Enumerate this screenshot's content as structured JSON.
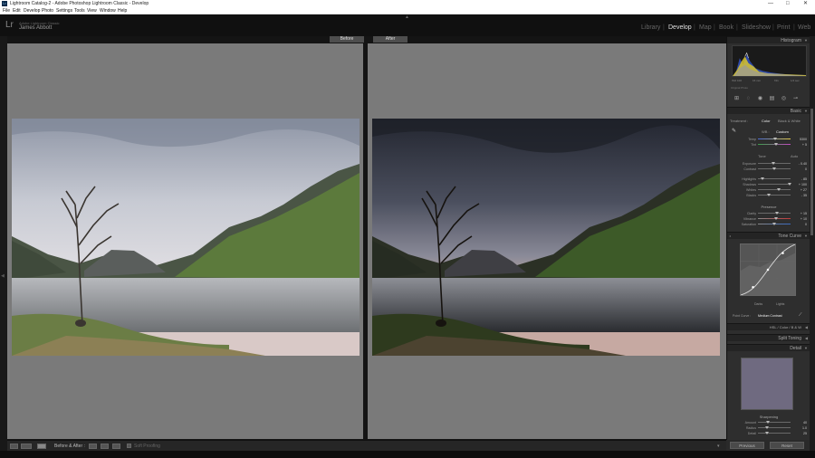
{
  "window": {
    "title": "Lightroom Catalog-2 - Adobe Photoshop Lightroom Classic - Develop",
    "controls": {
      "minimize": "—",
      "maximize": "□",
      "close": "✕"
    }
  },
  "menu": [
    "File",
    "Edit",
    "Develop",
    "Photo",
    "Settings",
    "Tools",
    "View",
    "Window",
    "Help"
  ],
  "identity": {
    "logo": "Lr",
    "catalog": "Adobe Lightroom Classic",
    "user": "James Abbott"
  },
  "modules": [
    {
      "label": "Library",
      "active": false
    },
    {
      "label": "Develop",
      "active": true
    },
    {
      "label": "Map",
      "active": false
    },
    {
      "label": "Book",
      "active": false
    },
    {
      "label": "Slideshow",
      "active": false
    },
    {
      "label": "Print",
      "active": false
    },
    {
      "label": "Web",
      "active": false
    }
  ],
  "compare": {
    "before": "Before",
    "after": "After"
  },
  "toolbar": {
    "view_mode": "Before & After :",
    "soft_proofing": "Soft Proofing"
  },
  "panels": {
    "histogram": {
      "title": "Histogram",
      "meta": [
        "ISO 100",
        "16 mm",
        "f/11",
        "1/4 sec"
      ],
      "original": "Original Photo"
    },
    "basic": {
      "title": "Basic",
      "treatment_label": "Treatment :",
      "treatment_color": "Color",
      "treatment_bw": "Black & White",
      "wb_label": "WB :",
      "wb_value": "Custom",
      "rows_wb": [
        {
          "label": "Temp",
          "value": "5300"
        },
        {
          "label": "Tint",
          "value": "+ 5"
        }
      ],
      "tone_head": "Tone",
      "tone_auto": "Auto",
      "rows_tone": [
        {
          "label": "Exposure",
          "value": "- 0.40"
        },
        {
          "label": "Contrast",
          "value": "0"
        },
        {
          "label": "Highlights",
          "value": "- 85"
        },
        {
          "label": "Shadows",
          "value": "+ 100"
        },
        {
          "label": "Whites",
          "value": "+ 27"
        },
        {
          "label": "Blacks",
          "value": "- 35"
        }
      ],
      "presence_head": "Presence",
      "rows_presence": [
        {
          "label": "Clarity",
          "value": "+ 15"
        },
        {
          "label": "Vibrance",
          "value": "+ 10"
        },
        {
          "label": "Saturation",
          "value": "0"
        }
      ]
    },
    "tone_curve": {
      "title": "Tone Curve",
      "lights": "Lights",
      "darks": "Darks",
      "channel_label": "Point Curve :",
      "channel_value": "Medium Contrast"
    },
    "hsl": {
      "title": "HSL / Color / B&W",
      "tabs": [
        "HSL",
        "Color",
        "B & W"
      ]
    },
    "split_toning": {
      "title": "Split Toning"
    },
    "detail": {
      "title": "Detail",
      "sharpening": "Sharpening",
      "rows": [
        {
          "label": "Amount",
          "value": "40"
        },
        {
          "label": "Radius",
          "value": "1.0"
        },
        {
          "label": "Detail",
          "value": "25"
        }
      ]
    }
  },
  "bottom_buttons": {
    "previous": "Previous",
    "reset": "Reset"
  }
}
